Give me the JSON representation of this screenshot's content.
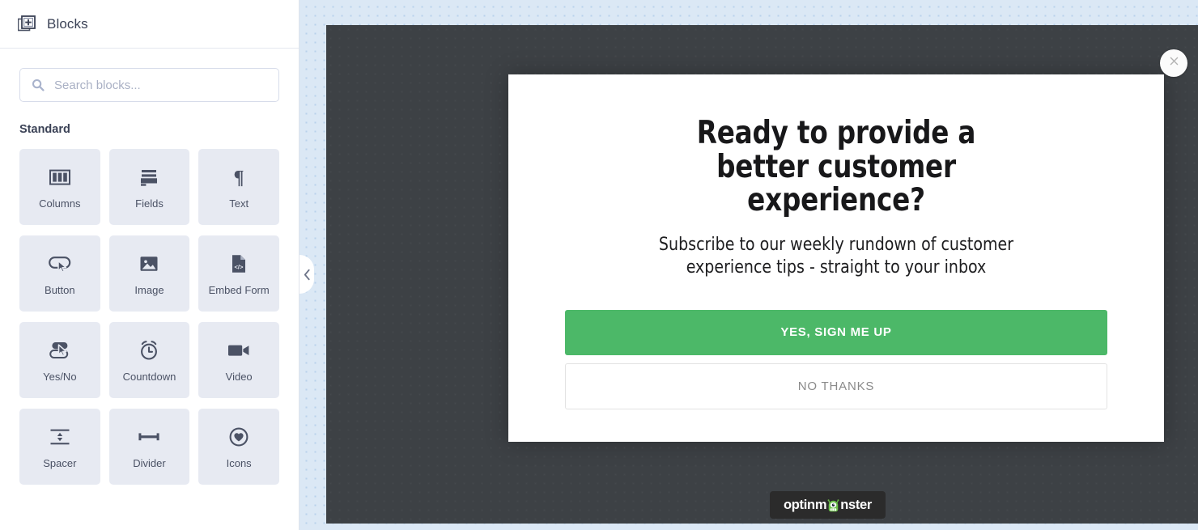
{
  "sidebar": {
    "header": {
      "icon": "blocks-add-icon",
      "title": "Blocks"
    },
    "search": {
      "icon": "search-icon",
      "placeholder": "Search blocks...",
      "value": ""
    },
    "section_title": "Standard",
    "blocks": [
      {
        "label": "Columns",
        "icon": "columns-icon"
      },
      {
        "label": "Fields",
        "icon": "form-fields-icon"
      },
      {
        "label": "Text",
        "icon": "paragraph-pilcrow-icon"
      },
      {
        "label": "Button",
        "icon": "button-cursor-icon"
      },
      {
        "label": "Image",
        "icon": "image-picture-icon"
      },
      {
        "label": "Embed Form",
        "icon": "embed-code-file-icon"
      },
      {
        "label": "Yes/No",
        "icon": "yes-no-toggle-icon"
      },
      {
        "label": "Countdown",
        "icon": "alarm-clock-icon"
      },
      {
        "label": "Video",
        "icon": "video-camera-icon"
      },
      {
        "label": "Spacer",
        "icon": "spacer-arrows-icon"
      },
      {
        "label": "Divider",
        "icon": "divider-line-icon"
      },
      {
        "label": "Icons",
        "icon": "heart-circle-icon"
      }
    ],
    "collapse_handle": {
      "icon": "chevron-left-icon",
      "label": ""
    }
  },
  "canvas": {
    "popup": {
      "close_icon": "close-x-icon",
      "headline": "Ready to provide a better customer experience?",
      "subheadline": "Subscribe to our weekly rundown of customer experience tips - straight to your inbox",
      "primary_button": "YES, SIGN ME UP",
      "secondary_button": "NO THANKS"
    },
    "badge": {
      "text_before": "optinm",
      "text_after": "nster",
      "logo_icon": "optinmonster-monster-logo"
    }
  },
  "colors": {
    "accent_green": "#4cb868",
    "stage_dark": "#3d4145",
    "canvas_blue": "#dbe8f5",
    "sidebar_card": "#e7eaf2",
    "icon_slate": "#4b5265",
    "badge_dark": "#2b2b2b"
  }
}
